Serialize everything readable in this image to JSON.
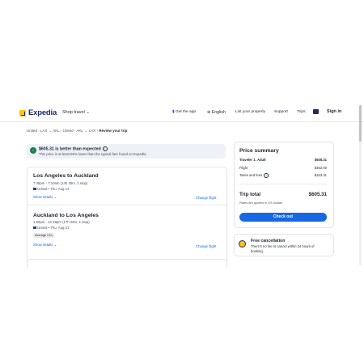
{
  "header": {
    "brand": "Expedia",
    "shop_travel": "Shop travel",
    "get_app": "Get the app",
    "language": "English",
    "list_property": "List your property",
    "support": "Support",
    "trips": "Trips",
    "sign_in": "Sign in"
  },
  "breadcrumb": {
    "step1": "United - LAX",
    "step1b": "AKL",
    "step2": "United - AKL",
    "step2b": "LAX",
    "current": "Review your trip"
  },
  "banner": {
    "headline": "$605.31 is better than expected",
    "detail": "This price is at least 59% lower than the typical fare found on Expedia"
  },
  "flights": [
    {
      "title": "Los Angeles to Auckland",
      "times": "7:45pm - 7:10am (14h 25m, 1 stop)",
      "airline": "United • Thu, Aug 14",
      "show_details": "Show details",
      "change": "Change flight"
    },
    {
      "title": "Auckland to Los Angeles",
      "times": "1:50pm - 12:18pm (17h 28m, 1 stop)",
      "airline": "United • Thu, Aug 21",
      "badge": "Average CO₂",
      "show_details": "Show details",
      "change": "Change flight"
    }
  ],
  "price_summary": {
    "title": "Price summary",
    "traveler": "Traveler 1: Adult",
    "traveler_total": "$605.31",
    "flight_label": "Flight",
    "flight_value": "$452.00",
    "taxes_label": "Taxes and fees",
    "taxes_value": "$153.31",
    "trip_total_label": "Trip total",
    "trip_total_value": "$605.31",
    "currency_note": "Rates are quoted in US dollars",
    "checkout": "Check out"
  },
  "cancellation": {
    "title": "Free cancellation",
    "detail": "There's no fee to cancel within 24 hours of booking."
  },
  "colors": {
    "brand_navy": "#1b2b66",
    "accent_blue": "#1668e3",
    "logo_yellow": "#fcc60f",
    "success_green": "#1a7f4b"
  }
}
